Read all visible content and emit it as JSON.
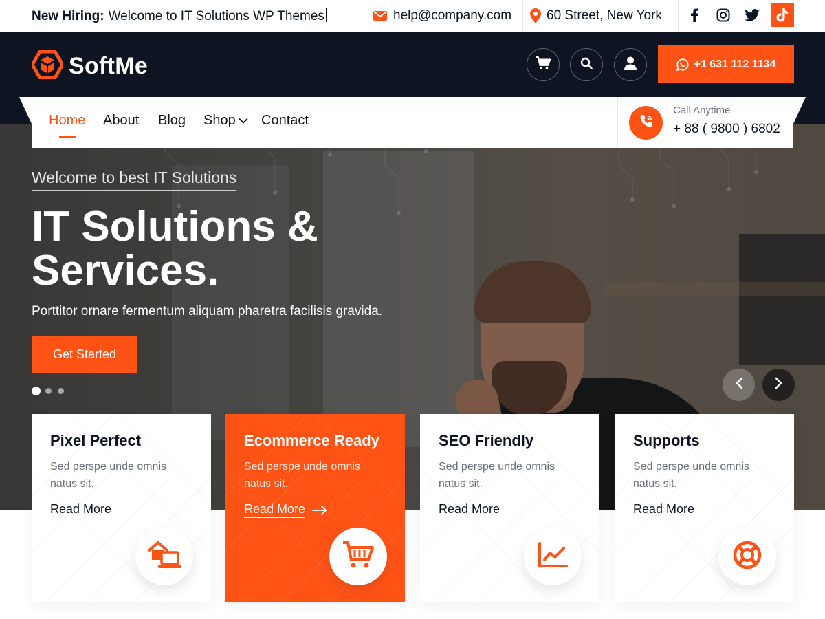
{
  "topbar": {
    "hiring_label": "New Hiring:",
    "hiring_text": "Welcome to IT Solutions WP Themes",
    "email": "help@company.com",
    "address": "60 Street, New York",
    "social": [
      "facebook-icon",
      "instagram-icon",
      "twitter-icon",
      "tiktok-icon"
    ]
  },
  "header": {
    "logo_text": "SoftMe",
    "actions": [
      "cart-icon",
      "search-icon",
      "user-icon"
    ],
    "phone": "+1 631 112 1134"
  },
  "nav": {
    "items": [
      {
        "label": "Home",
        "active": true
      },
      {
        "label": "About",
        "active": false
      },
      {
        "label": "Blog",
        "active": false
      },
      {
        "label": "Shop",
        "active": false
      },
      {
        "label": "Contact",
        "active": false
      }
    ],
    "call_label": "Call Anytime",
    "call_number": "+ 88 ( 9800 ) 6802"
  },
  "hero": {
    "subtitle": "Welcome to best IT Solutions",
    "title_line1": "IT Solutions &",
    "title_line2": "Services.",
    "text": "Porttitor ornare fermentum aliquam pharetra facilisis gravida.",
    "button": "Get Started",
    "slides": 3,
    "active_slide": 1
  },
  "features": [
    {
      "title": "Pixel Perfect",
      "text": "Sed perspe unde omnis natus sit.",
      "link": "Read More",
      "icon": "laptop-home-icon",
      "highlight": false
    },
    {
      "title": "Ecommerce Ready",
      "text": "Sed perspe unde omnis natus sit.",
      "link": "Read More",
      "icon": "cart-icon",
      "highlight": true
    },
    {
      "title": "SEO Friendly",
      "text": "Sed perspe unde omnis natus sit.",
      "link": "Read More",
      "icon": "chart-line-icon",
      "highlight": false
    },
    {
      "title": "Supports",
      "text": "Sed perspe unde omnis natus sit.",
      "link": "Read More",
      "icon": "lifebuoy-icon",
      "highlight": false
    }
  ],
  "colors": {
    "accent": "#ff5316",
    "dark": "#0e1422",
    "muted": "#6b6f7a"
  }
}
